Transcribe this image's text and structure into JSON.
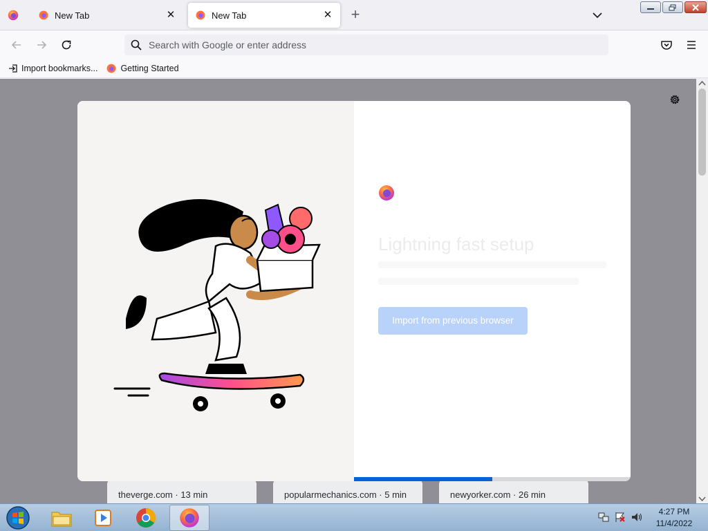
{
  "tabs": [
    {
      "label": "New Tab",
      "active": false
    },
    {
      "label": "New Tab",
      "active": true
    }
  ],
  "navbar": {
    "search_placeholder": "Search with Google or enter address"
  },
  "bookmarks": [
    {
      "label": "Import bookmarks...",
      "icon": "import-icon"
    },
    {
      "label": "Getting Started",
      "icon": "firefox-icon"
    }
  ],
  "modal": {
    "title": "Lightning fast setup",
    "primary_button": "Import from previous browser",
    "progress": 0.5
  },
  "top_sites": [
    {
      "label": "theverge.com · 13 min"
    },
    {
      "label": "popularmechanics.com · 5 min"
    },
    {
      "label": "newyorker.com · 26 min"
    }
  ],
  "taskbar": {
    "apps": [
      "windows-explorer",
      "media-player",
      "chrome",
      "firefox"
    ],
    "time": "4:27 PM",
    "date": "11/4/2022"
  },
  "colors": {
    "accent": "#0a62d8",
    "button_disabled": "#b8d2fa",
    "overlay": "#8f8f95"
  }
}
